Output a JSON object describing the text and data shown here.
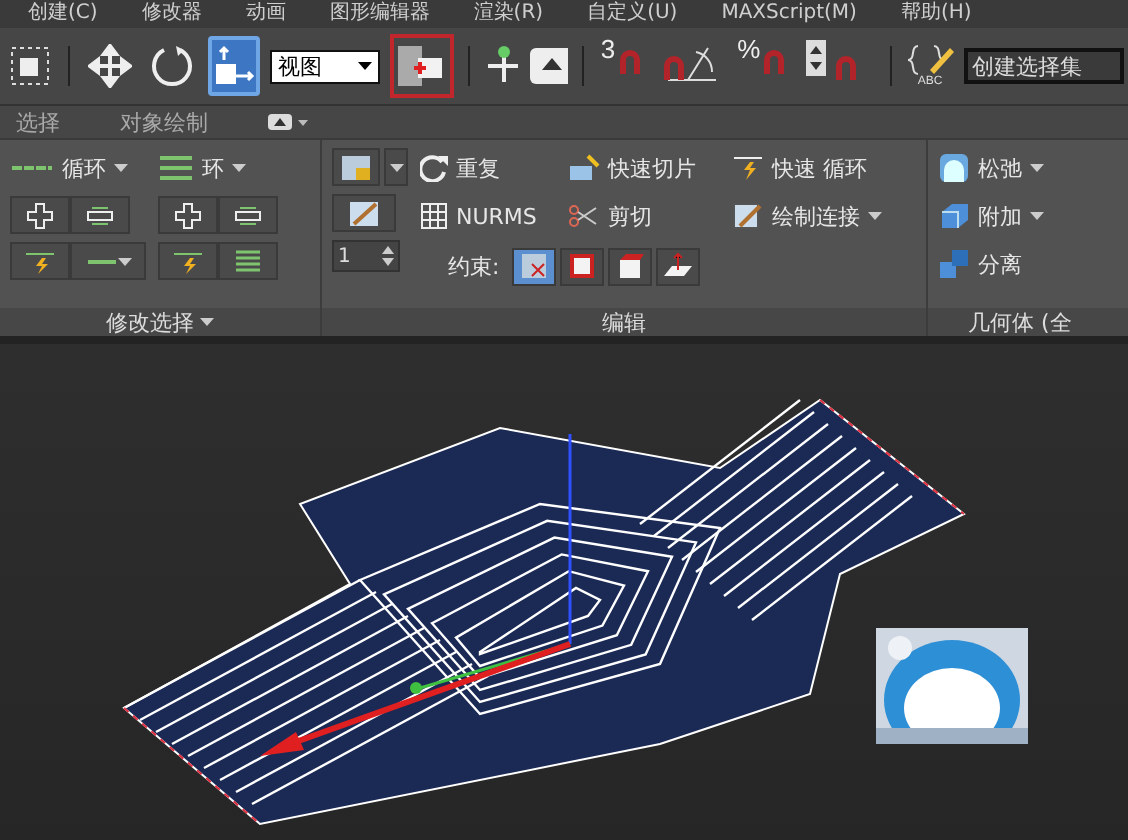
{
  "menu_bar": [
    "创建(C)",
    "修改器",
    "动画",
    "图形编辑器",
    "渲染(R)",
    "自定义(U)",
    "MAXScript(M)",
    "帮助(H)"
  ],
  "toolbar": {
    "tools": [
      {
        "kind": "select-object",
        "selected": false
      },
      {
        "kind": "move",
        "selected": false
      },
      {
        "kind": "rotate",
        "selected": false
      },
      {
        "kind": "select-region",
        "selected": true
      }
    ],
    "view_dropdown": "视图",
    "pivot_button": {
      "highlighted": true
    },
    "snaps": [
      {
        "kind": "grid",
        "label": "3"
      },
      {
        "kind": "angle"
      },
      {
        "kind": "percent",
        "label": "%"
      },
      {
        "kind": "spinner"
      }
    ],
    "edit_sets_label": "ABC",
    "named_set_field": "创建选择集"
  },
  "ribbon_tabs": [
    {
      "label": "选择"
    },
    {
      "label": "对象绘制"
    }
  ],
  "ribbon": {
    "modify_selection": {
      "title": "修改选择",
      "commands": [
        {
          "label": "循环"
        },
        {
          "label": "环"
        }
      ]
    },
    "edit": {
      "title": "编辑",
      "spinner_value": "1",
      "commands": [
        {
          "label": "重复",
          "dropdown": false
        },
        {
          "label": "快速切片",
          "dropdown": false
        },
        {
          "label": "快速 循环",
          "dropdown": false
        },
        {
          "label": "NURMS",
          "dropdown": false
        },
        {
          "label": "剪切",
          "dropdown": false
        },
        {
          "label": "绘制连接",
          "dropdown": true
        }
      ],
      "constraint_label": "约束:",
      "constraints": [
        {
          "selected": true
        },
        {
          "selected": false
        },
        {
          "selected": false
        },
        {
          "selected": false
        }
      ]
    },
    "geometry": {
      "title": "几何体 (全",
      "commands": [
        {
          "label": "松弛",
          "dropdown": true
        },
        {
          "label": "附加",
          "dropdown": true
        },
        {
          "label": "分离",
          "dropdown": false
        }
      ]
    }
  }
}
